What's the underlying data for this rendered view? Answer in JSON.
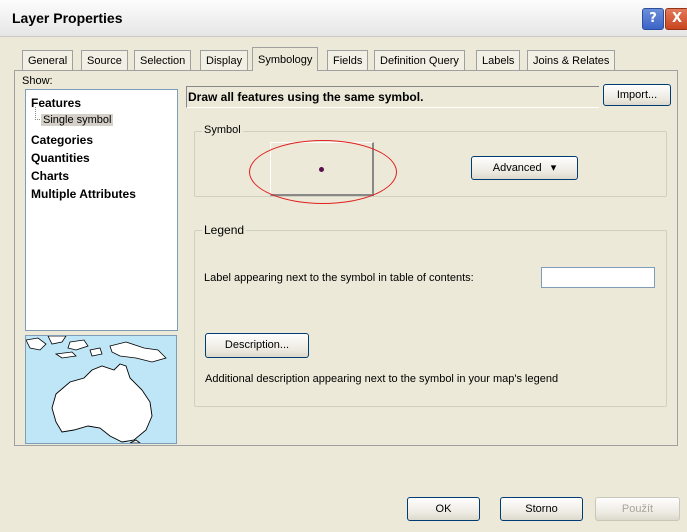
{
  "window": {
    "title": "Layer Properties",
    "help_glyph": "?",
    "close_glyph": "X"
  },
  "tabs": [
    {
      "label": "General"
    },
    {
      "label": "Source"
    },
    {
      "label": "Selection"
    },
    {
      "label": "Display"
    },
    {
      "label": "Symbology"
    },
    {
      "label": "Fields"
    },
    {
      "label": "Definition Query"
    },
    {
      "label": "Labels"
    },
    {
      "label": "Joins & Relates"
    }
  ],
  "active_tab": "Symbology",
  "show": {
    "label": "Show:",
    "items": [
      "Features",
      "Single symbol",
      "Categories",
      "Quantities",
      "Charts",
      "Multiple Attributes"
    ]
  },
  "symbology": {
    "header": "Draw all features using the same symbol.",
    "import_label": "Import...",
    "symbol_group_title": "Symbol",
    "symbol_color": "#5a0f4f",
    "advanced_label": "Advanced",
    "advanced_arrow": "▾"
  },
  "legend": {
    "group_title": "Legend",
    "label_text": "Label appearing next to the symbol in table of contents:",
    "label_value": "",
    "description_button": "Description...",
    "description_text": "Additional description appearing next to the symbol in your map's legend"
  },
  "buttons": {
    "ok": "OK",
    "storno": "Storno",
    "pouzit": "Použít"
  },
  "colors": {
    "highlight": "#e02020",
    "window_bg": "#ece9d8"
  }
}
